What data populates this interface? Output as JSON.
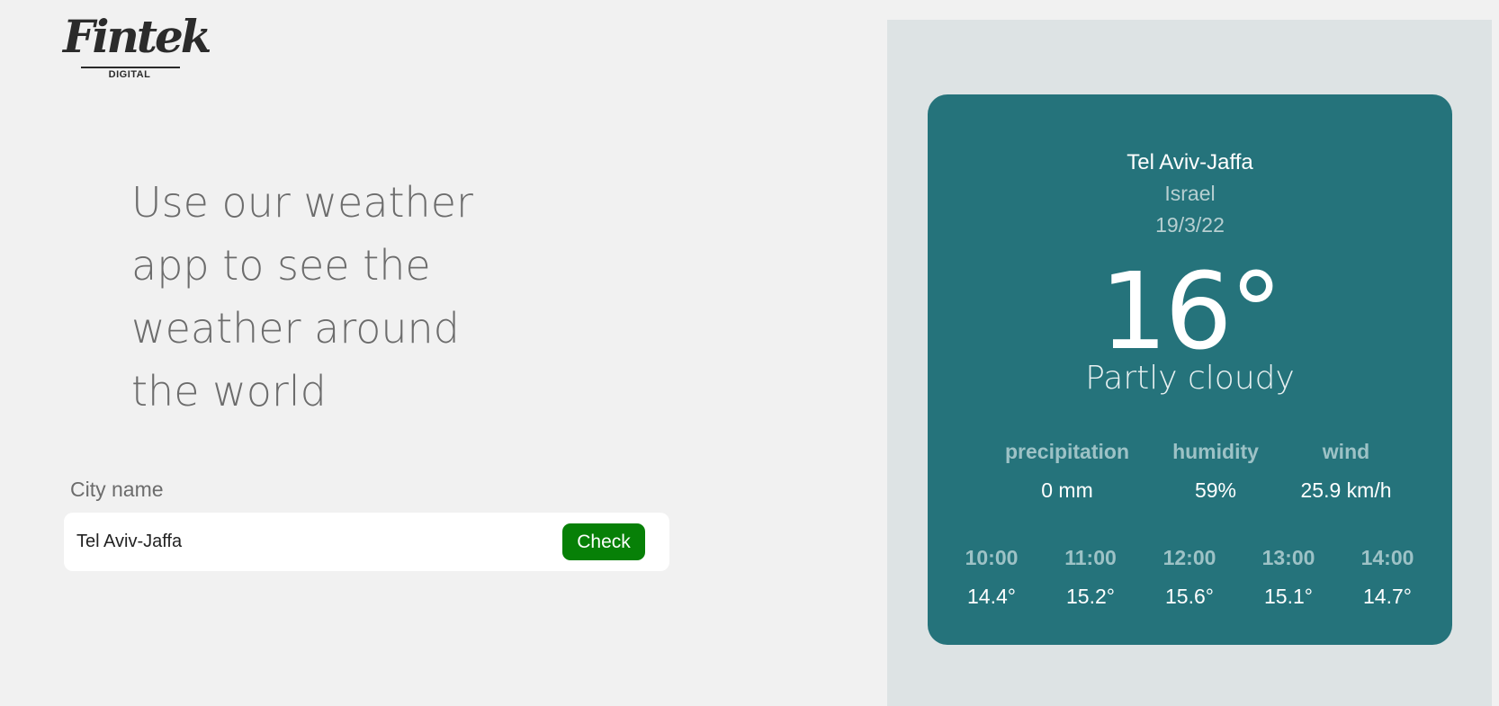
{
  "logo": {
    "main": "Fintek",
    "sub": "DIGITAL"
  },
  "headline": [
    "Use our weather",
    "app to see the",
    "weather around",
    "the world"
  ],
  "search": {
    "label": "City name",
    "value": "Tel Aviv-Jaffa",
    "button": "Check"
  },
  "weather": {
    "city": "Tel Aviv-Jaffa",
    "country": "Israel",
    "date": "19/3/22",
    "temperature": "16°",
    "description": "Partly cloudy",
    "stats": [
      {
        "label": "precipitation",
        "value": "0 mm"
      },
      {
        "label": "humidity",
        "value": "59%"
      },
      {
        "label": "wind",
        "value": "25.9 km/h"
      }
    ],
    "hourly": [
      {
        "time": "10:00",
        "temp": "14.4°"
      },
      {
        "time": "11:00",
        "temp": "15.2°"
      },
      {
        "time": "12:00",
        "temp": "15.6°"
      },
      {
        "time": "13:00",
        "temp": "15.1°"
      },
      {
        "time": "14:00",
        "temp": "14.7°"
      }
    ]
  },
  "colors": {
    "background": "#f1f1f1",
    "panel": "#dde3e4",
    "card": "#25737b",
    "button": "#078007",
    "muted_text": "#6c6c6c"
  }
}
